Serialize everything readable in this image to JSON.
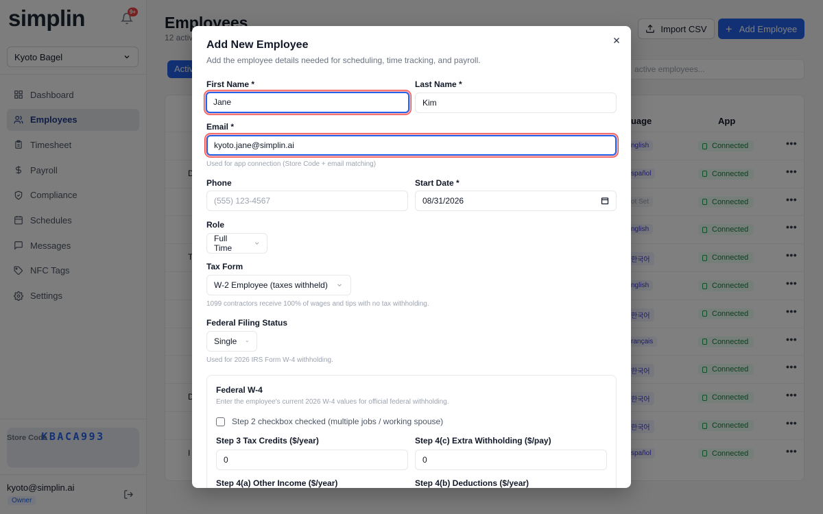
{
  "sidebar": {
    "logo": "simplin",
    "notification_badge": "9+",
    "store_name": "Kyoto Bagel",
    "nav": [
      {
        "label": "Dashboard",
        "icon": "dashboard-icon"
      },
      {
        "label": "Employees",
        "icon": "users-icon",
        "active": true
      },
      {
        "label": "Timesheet",
        "icon": "clipboard-icon"
      },
      {
        "label": "Payroll",
        "icon": "dollar-icon"
      },
      {
        "label": "Compliance",
        "icon": "shield-check-icon"
      },
      {
        "label": "Schedules",
        "icon": "calendar-icon"
      },
      {
        "label": "Messages",
        "icon": "message-icon"
      },
      {
        "label": "NFC Tags",
        "icon": "tag-icon"
      },
      {
        "label": "Settings",
        "icon": "gear-icon"
      }
    ],
    "store_code_label": "Store Code",
    "store_code": "KBACA993",
    "user_email": "kyoto@simplin.ai",
    "user_role": "Owner"
  },
  "main": {
    "title": "Employees",
    "subtitle": "12 activ",
    "import_button": "Import CSV",
    "add_button": "Add Employee",
    "active_tab": "Activ",
    "search_placeholder": "active employees...",
    "headers": {
      "language": "guage",
      "app": "App"
    },
    "rows": [
      {
        "lang": "nglish",
        "app": "Connected",
        "name_frag": ""
      },
      {
        "lang": "spañol",
        "app": "Connected",
        "name_frag": "D"
      },
      {
        "lang": "ot Set",
        "app": "Connected",
        "name_frag": "",
        "lang_notset": true
      },
      {
        "lang": "nglish",
        "app": "Connected",
        "name_frag": ""
      },
      {
        "lang": "한국어",
        "app": "Connected",
        "name_frag": "T"
      },
      {
        "lang": "nglish",
        "app": "Connected",
        "name_frag": ""
      },
      {
        "lang": "한국어",
        "app": "Connected",
        "name_frag": ""
      },
      {
        "lang": "rançais",
        "app": "Connected",
        "name_frag": ""
      },
      {
        "lang": "한국어",
        "app": "Connected",
        "name_frag": ""
      },
      {
        "lang": "한국어",
        "app": "Connected",
        "name_frag": "D"
      },
      {
        "lang": "한국어",
        "app": "Connected",
        "name_frag": ""
      },
      {
        "lang": "spañol",
        "app": "Connected",
        "name_frag": "I"
      }
    ]
  },
  "modal": {
    "title": "Add New Employee",
    "description": "Add the employee details needed for scheduling, time tracking, and payroll.",
    "first_name": {
      "label": "First Name *",
      "value": "Jane"
    },
    "last_name": {
      "label": "Last Name *",
      "value": "Kim"
    },
    "email": {
      "label": "Email *",
      "value": "kyoto.jane@simplin.ai",
      "hint": "Used for app connection (Store Code + email matching)"
    },
    "phone": {
      "label": "Phone",
      "placeholder": "(555) 123-4567"
    },
    "start_date": {
      "label": "Start Date *",
      "value": "08/31/2026"
    },
    "role": {
      "label": "Role",
      "value": "Full Time"
    },
    "tax_form": {
      "label": "Tax Form",
      "value": "W-2 Employee (taxes withheld)",
      "hint": "1099 contractors receive 100% of wages and tips with no tax withholding."
    },
    "filing_status": {
      "label": "Federal Filing Status",
      "value": "Single",
      "hint": "Used for 2026 IRS Form W-4 withholding."
    },
    "w4": {
      "title": "Federal W-4",
      "description": "Enter the employee's current 2026 W-4 values for official federal withholding.",
      "step2_label": "Step 2 checkbox checked (multiple jobs / working spouse)",
      "step3_label": "Step 3 Tax Credits ($/year)",
      "step3_value": "0",
      "step4c_label": "Step 4(c) Extra Withholding ($/pay)",
      "step4c_value": "0",
      "step4a_label": "Step 4(a) Other Income ($/year)",
      "step4b_label": "Step 4(b) Deductions ($/year)"
    }
  }
}
